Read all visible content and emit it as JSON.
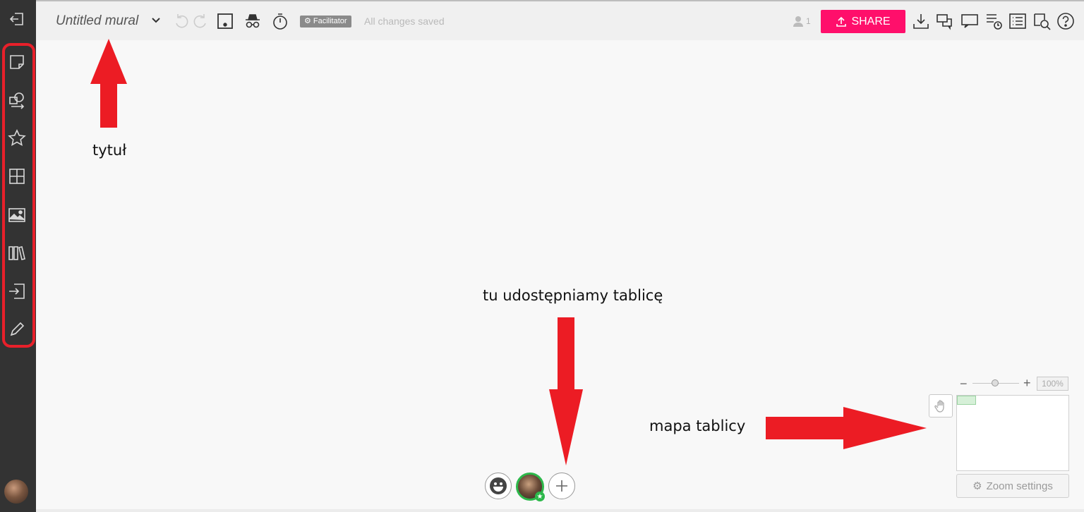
{
  "header": {
    "title": "Untitled mural",
    "badge": "Facilitator",
    "status": "All changes saved",
    "user_count": "1",
    "share_label": "SHARE"
  },
  "sidebar": {
    "items": [
      "exit-icon",
      "sticky-note-icon",
      "shapes-icon",
      "star-icon",
      "grid-icon",
      "image-icon",
      "library-icon",
      "import-icon",
      "pencil-icon"
    ]
  },
  "annotations": {
    "title_label": "tytuł",
    "share_label": "tu  udostępniamy  tablicę",
    "map_label": "mapa tablicy"
  },
  "zoom": {
    "level": "100%",
    "settings_label": "Zoom settings",
    "minus": "−",
    "plus": "+"
  },
  "colors": {
    "sidebar": "#333333",
    "share": "#ff0f6b",
    "annotation_red": "#ec1c24",
    "active_green": "#2db84b"
  }
}
